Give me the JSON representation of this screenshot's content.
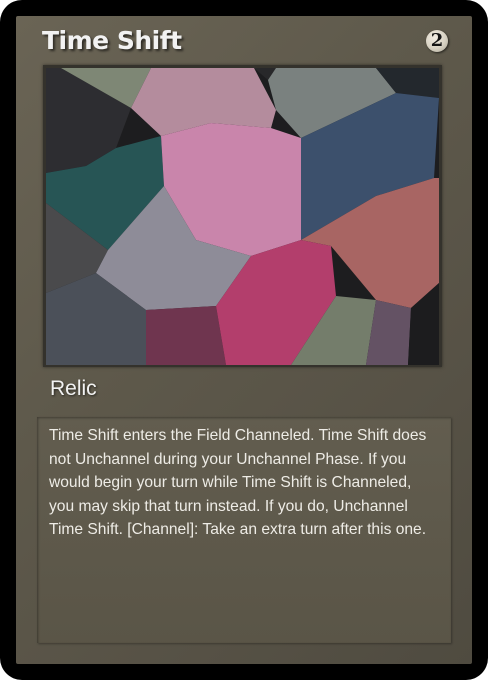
{
  "card": {
    "title": "Time Shift",
    "cost": "2",
    "type": "Relic",
    "rules_text": "Time Shift enters the Field Channeled. Time Shift does not Unchannel during your Unchannel Phase. If you would begin your turn while Time Shift is Channeled, you may skip that turn instead. If you do, Unchannel Time Shift. [Channel]: Take an extra turn after this one."
  },
  "colors": {
    "frame": "#5e594b",
    "border": "#000000",
    "text": "#eeece6"
  },
  "icons": {
    "cost": "coin-icon"
  }
}
